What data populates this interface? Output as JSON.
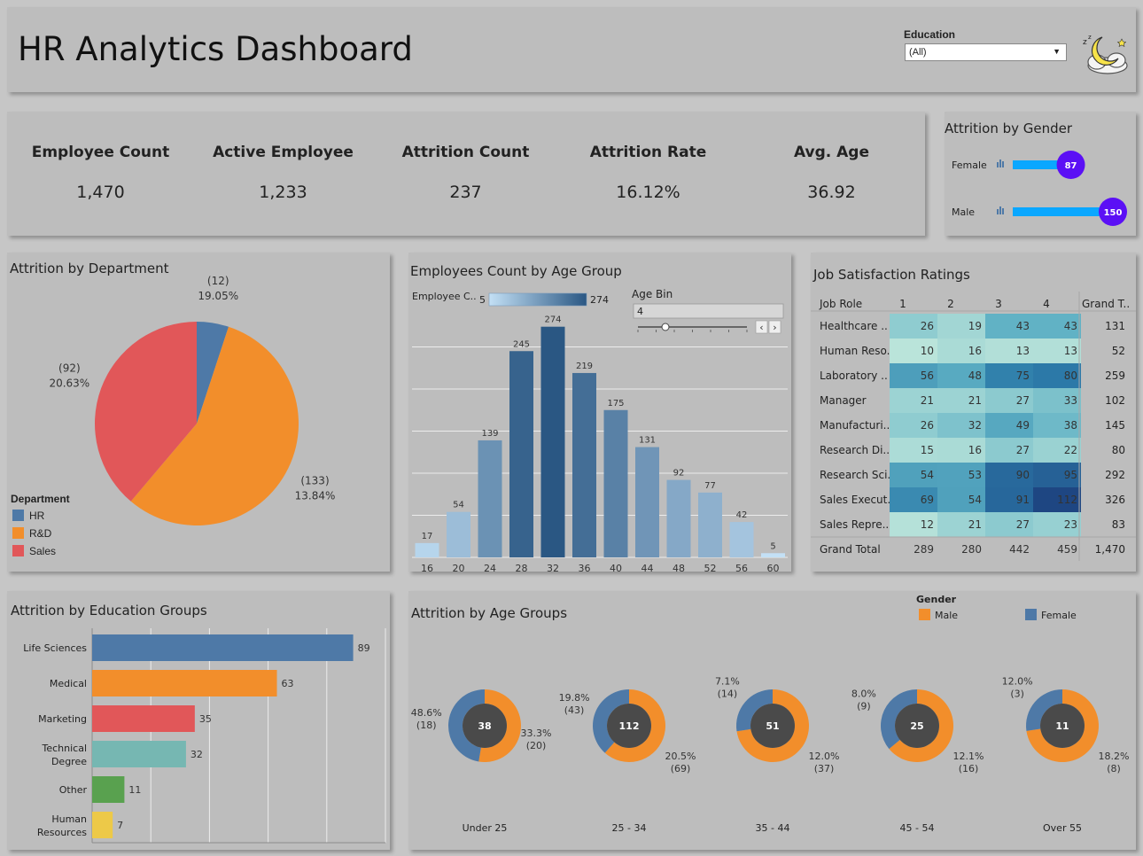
{
  "header": {
    "title": "HR Analytics Dashboard",
    "filter_label": "Education",
    "filter_value": "(All)"
  },
  "kpis": [
    {
      "label": "Employee Count",
      "value": "1,470"
    },
    {
      "label": "Active Employee",
      "value": "1,233"
    },
    {
      "label": "Attrition Count",
      "value": "237"
    },
    {
      "label": "Attrition Rate",
      "value": "16.12%"
    },
    {
      "label": "Avg. Age",
      "value": "36.92"
    }
  ],
  "titles": {
    "gender": "Attrition by Gender",
    "dept": "Attrition by Department",
    "agegroup": "Employees Count by Age Group",
    "jobsat": "Job Satisfaction Ratings",
    "edu": "Attrition by Education Groups",
    "ageatt": "Attrition by Age Groups"
  },
  "colors": {
    "blue": "#4e79a7",
    "orange": "#f28e2b",
    "red": "#e15759",
    "teal": "#76b7b2",
    "green": "#59a14f",
    "yellow": "#edc948",
    "gender_bar": "#0aa7ff",
    "gender_dot": "#5b10f5",
    "donut_center": "#4a4a4a"
  },
  "chart_data": [
    {
      "id": "gender",
      "type": "bar",
      "title": "Attrition by Gender",
      "categories": [
        "Female",
        "Male"
      ],
      "values": [
        87,
        150
      ],
      "xlim": [
        0,
        150
      ]
    },
    {
      "id": "dept",
      "type": "pie",
      "title": "Attrition by Department",
      "legend_title": "Department",
      "legend_position": "bottom-left",
      "slices": [
        {
          "label": "HR",
          "value": 12,
          "pct": "19.05%",
          "color": "#4e79a7"
        },
        {
          "label": "R&D",
          "value": 133,
          "pct": "13.84%",
          "color": "#f28e2b"
        },
        {
          "label": "Sales",
          "value": 92,
          "pct": "20.63%",
          "color": "#e15759"
        }
      ]
    },
    {
      "id": "agegroup",
      "type": "bar",
      "title": "Employees Count by Age Group",
      "legend_label": "Employee C..",
      "legend_min": "5",
      "legend_max": "274",
      "slider_label": "Age Bin",
      "slider_value": "4",
      "categories": [
        "16",
        "20",
        "24",
        "28",
        "32",
        "36",
        "40",
        "44",
        "48",
        "52",
        "56",
        "60"
      ],
      "values": [
        17,
        54,
        139,
        245,
        274,
        219,
        175,
        131,
        92,
        77,
        42,
        5
      ],
      "ylim": [
        0,
        280
      ]
    },
    {
      "id": "jobsat",
      "type": "heatmap",
      "title": "Job Satisfaction Ratings",
      "row_header": "Job Role",
      "columns": [
        "1",
        "2",
        "3",
        "4"
      ],
      "total_header": "Grand T..",
      "rows": [
        {
          "label": "Healthcare ..",
          "values": [
            26,
            19,
            43,
            43
          ],
          "total": "131"
        },
        {
          "label": "Human Reso..",
          "values": [
            10,
            16,
            13,
            13
          ],
          "total": "52"
        },
        {
          "label": "Laboratory ..",
          "values": [
            56,
            48,
            75,
            80
          ],
          "total": "259"
        },
        {
          "label": "Manager",
          "values": [
            21,
            21,
            27,
            33
          ],
          "total": "102"
        },
        {
          "label": "Manufacturi..",
          "values": [
            26,
            32,
            49,
            38
          ],
          "total": "145"
        },
        {
          "label": "Research Di..",
          "values": [
            15,
            16,
            27,
            22
          ],
          "total": "80"
        },
        {
          "label": "Research Sci..",
          "values": [
            54,
            53,
            90,
            95
          ],
          "total": "292"
        },
        {
          "label": "Sales Execut..",
          "values": [
            69,
            54,
            91,
            112
          ],
          "total": "326"
        },
        {
          "label": "Sales Repre..",
          "values": [
            12,
            21,
            27,
            23
          ],
          "total": "83"
        }
      ],
      "grand_total": {
        "label": "Grand Total",
        "values": [
          "289",
          "280",
          "442",
          "459"
        ],
        "total": "1,470"
      }
    },
    {
      "id": "edu",
      "type": "bar",
      "title": "Attrition by Education Groups",
      "categories": [
        [
          "Life Sciences"
        ],
        [
          "Medical"
        ],
        [
          "Marketing"
        ],
        [
          "Technical",
          "Degree"
        ],
        [
          "Other"
        ],
        [
          "Human",
          "Resources"
        ]
      ],
      "values": [
        89,
        63,
        35,
        32,
        11,
        7
      ],
      "colors": [
        "#4e79a7",
        "#f28e2b",
        "#e15759",
        "#76b7b2",
        "#59a14f",
        "#edc948"
      ],
      "xlim": [
        0,
        100
      ]
    },
    {
      "id": "ageatt",
      "type": "pie",
      "title": "Attrition by Age Groups",
      "legend_title": "Gender",
      "legend_position": "top-right",
      "legend": [
        {
          "label": "Male",
          "color": "#f28e2b"
        },
        {
          "label": "Female",
          "color": "#4e79a7"
        }
      ],
      "groups": [
        {
          "label": "Under 25",
          "total": 38,
          "female": 18,
          "female_pct": "48.6%",
          "male": 20,
          "male_pct": "33.3%"
        },
        {
          "label": "25 - 34",
          "total": 112,
          "female": 43,
          "female_pct": "19.8%",
          "male": 69,
          "male_pct": "20.5%"
        },
        {
          "label": "35 - 44",
          "total": 51,
          "female": 14,
          "female_pct": "7.1%",
          "male": 37,
          "male_pct": "12.0%"
        },
        {
          "label": "45 - 54",
          "total": 25,
          "female": 9,
          "female_pct": "8.0%",
          "male": 16,
          "male_pct": "12.1%"
        },
        {
          "label": "Over 55",
          "total": 11,
          "female": 3,
          "female_pct": "12.0%",
          "male": 8,
          "male_pct": "18.2%"
        }
      ]
    }
  ]
}
